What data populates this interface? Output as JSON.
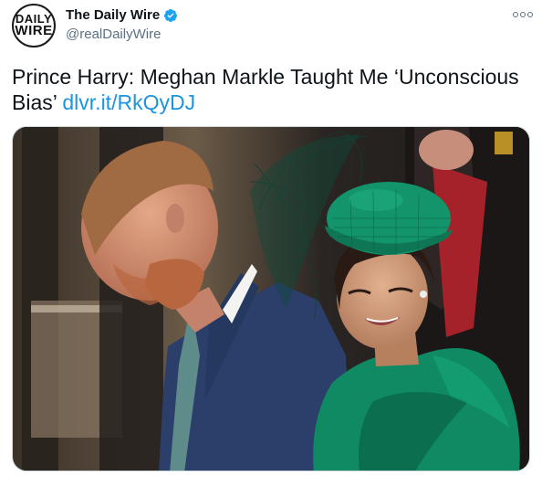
{
  "account": {
    "avatar_line1": "DAILY",
    "avatar_line2": "WIRE",
    "display_name": "The Daily Wire",
    "handle": "@realDailyWire",
    "verified": true
  },
  "tweet": {
    "text": "Prince Harry: Meghan Markle Taught Me ‘Unconscious Bias’",
    "link": "dlvr.it/RkQyDJ"
  },
  "icons": {
    "verified": "verified-badge-icon",
    "more": "more-options-icon"
  },
  "colors": {
    "link": "#1b95e0",
    "verified": "#1da1f2",
    "secondary_text": "#5b7083",
    "suit_navy": "#2c3f6b",
    "green_outfit": "#0f8a63"
  }
}
